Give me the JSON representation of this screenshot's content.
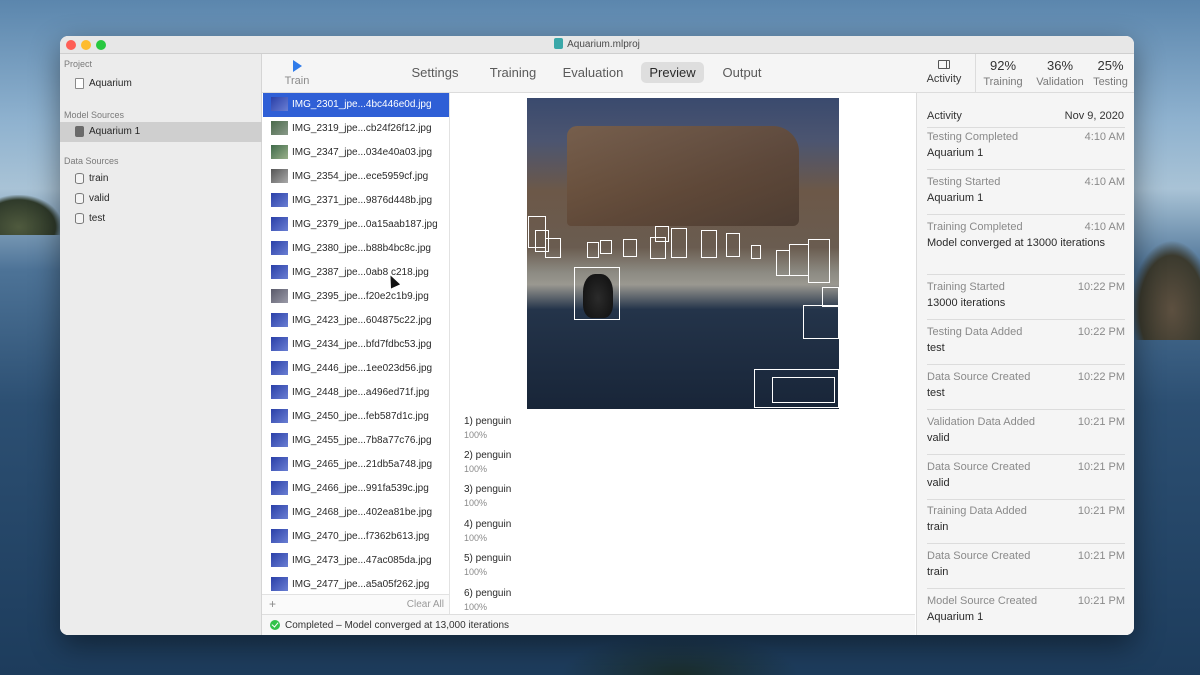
{
  "window": {
    "title": "Aquarium.mlproj"
  },
  "sidebar": {
    "project_header": "Project",
    "project_item": "Aquarium",
    "model_sources_header": "Model Sources",
    "model_item": "Aquarium 1",
    "data_sources_header": "Data Sources",
    "data_items": [
      "train",
      "valid",
      "test"
    ]
  },
  "toolbar": {
    "train_label": "Train",
    "tabs": [
      "Settings",
      "Training",
      "Evaluation",
      "Preview",
      "Output"
    ],
    "active_tab": "Preview",
    "activity_label": "Activity",
    "metrics": [
      {
        "value": "92%",
        "label": "Training"
      },
      {
        "value": "36%",
        "label": "Validation"
      },
      {
        "value": "25%",
        "label": "Testing"
      }
    ]
  },
  "image_list": {
    "items": [
      "IMG_2301_jpe...4bc446e0d.jpg",
      "IMG_2319_jpe...cb24f26f12.jpg",
      "IMG_2347_jpe...034e40a03.jpg",
      "IMG_2354_jpe...ece5959cf.jpg",
      "IMG_2371_jpe...9876d448b.jpg",
      "IMG_2379_jpe...0a15aab187.jpg",
      "IMG_2380_jpe...b88b4bc8c.jpg",
      "IMG_2387_jpe...0ab8 c218.jpg",
      "IMG_2395_jpe...f20e2c1b9.jpg",
      "IMG_2423_jpe...604875c22.jpg",
      "IMG_2434_jpe...bfd7fdbc53.jpg",
      "IMG_2446_jpe...1ee023d56.jpg",
      "IMG_2448_jpe...a496ed71f.jpg",
      "IMG_2450_jpe...feb587d1c.jpg",
      "IMG_2455_jpe...7b8a77c76.jpg",
      "IMG_2465_jpe...21db5a748.jpg",
      "IMG_2466_jpe...991fa539c.jpg",
      "IMG_2468_jpe...402ea81be.jpg",
      "IMG_2470_jpe...f7362b613.jpg",
      "IMG_2473_jpe...47ac085da.jpg",
      "IMG_2477_jpe...a5a05f262.jpg"
    ],
    "selected_index": 0,
    "clear_all_label": "Clear All"
  },
  "preview": {
    "detections": [
      {
        "label": "1) penguin",
        "confidence": "100%"
      },
      {
        "label": "2) penguin",
        "confidence": "100%"
      },
      {
        "label": "3) penguin",
        "confidence": "100%"
      },
      {
        "label": "4) penguin",
        "confidence": "100%"
      },
      {
        "label": "5) penguin",
        "confidence": "100%"
      },
      {
        "label": "6) penguin",
        "confidence": "100%"
      }
    ]
  },
  "activity": {
    "title": "Activity",
    "date": "Nov 9, 2020",
    "items": [
      {
        "title": "Testing Completed",
        "time": "4:10 AM",
        "detail": "Aquarium 1"
      },
      {
        "title": "Testing Started",
        "time": "4:10 AM",
        "detail": "Aquarium 1"
      },
      {
        "title": "Training Completed",
        "time": "4:10 AM",
        "detail": "Model converged at 13000 iterations"
      },
      {
        "title": "Training Started",
        "time": "10:22 PM",
        "detail": "13000 iterations"
      },
      {
        "title": "Testing Data Added",
        "time": "10:22 PM",
        "detail": "test"
      },
      {
        "title": "Data Source Created",
        "time": "10:22 PM",
        "detail": "test"
      },
      {
        "title": "Validation Data Added",
        "time": "10:21 PM",
        "detail": "valid"
      },
      {
        "title": "Data Source Created",
        "time": "10:21 PM",
        "detail": "valid"
      },
      {
        "title": "Training Data Added",
        "time": "10:21 PM",
        "detail": "train"
      },
      {
        "title": "Data Source Created",
        "time": "10:21 PM",
        "detail": "train"
      },
      {
        "title": "Model Source Created",
        "time": "10:21 PM",
        "detail": "Aquarium 1"
      }
    ]
  },
  "status": {
    "text": "Completed – Model converged at 13,000 iterations"
  }
}
